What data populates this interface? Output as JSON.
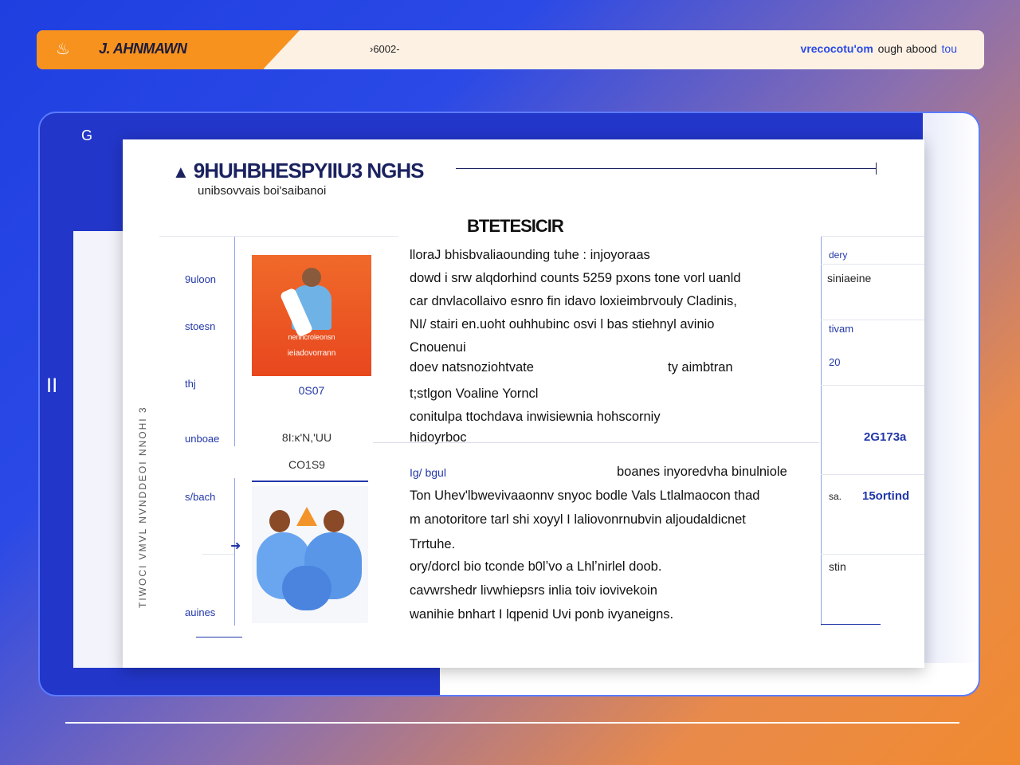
{
  "topbar": {
    "brand_icon": "flame-icon",
    "brand_title": "J. AHNMAWN",
    "center_text": "›6002‐",
    "links": {
      "primary": "vrecocotu'om",
      "secondary": "ough abood",
      "tertiary": "tou"
    }
  },
  "frame": {
    "corner_glyph": "G",
    "side_glyph": "ⅠⅠ"
  },
  "document": {
    "title": "9HUHBHESPYIIU3 NGHS",
    "subtitle": "unibsovvais boi'saibanoi",
    "section_title": "BTETESICIR",
    "side_labels": [
      "9uloon",
      "stoesn",
      "thj",
      "unboae",
      "s/bach",
      "auines"
    ],
    "vertical_text": "TIWOCI VMVL NVNDDEOI NNOHI 3",
    "card1": {
      "line1": "nenncroleonsn",
      "line2": "ieiadovorrann",
      "caption": "0S07"
    },
    "card2_captions": {
      "top": "8I:κ'N,'UU",
      "bottom": "CO1S9"
    },
    "body_lines_top": [
      "lloraJ bhisbvaliaounding tuhe : injoyoraas",
      "dowd i srw alqdorhind counts 5259 pxons tone vorl uanld",
      "car dnvlacollaivo esnro fin idavo loxieimbrvouly Cladinis,",
      "NI/ stairi en.uoht ouhhubinc osvi l bas stiehnyl avinio",
      "Cnouenui",
      "doev natsnoziohtvate",
      "t;stlgon Voaline Yorncl",
      "conitulpa ttochdava inwisiewnia hohscorniy",
      "hidoyrboc"
    ],
    "body_right_top": "ty aimbtran",
    "body_lines_bottom": [
      "Ig/ bgul",
      "Ton Uhev'lbwevivaaonnv snyoc bodle Vals Ltlalmaocon thad",
      "m anotoritore tarl shi xoyyl I laliovonrnubvin aljoudaldicnet",
      "Trrtuhe.",
      "ory/dorcl bio tconde b0lʼvo a Lhlʼnirlel doob.",
      "cavwrshedr livwhiepsrs inlia toiv iovivekoin",
      "wanihie bnhart I lqpenid Uvi ponb ivyaneigns."
    ],
    "body_right_bottom": "boanes inyoredvha binulniole",
    "right_labels": [
      "dery",
      "siniaeine",
      "tivam",
      "20",
      "2G173a",
      "sa.",
      "15ortind",
      "stin"
    ]
  }
}
